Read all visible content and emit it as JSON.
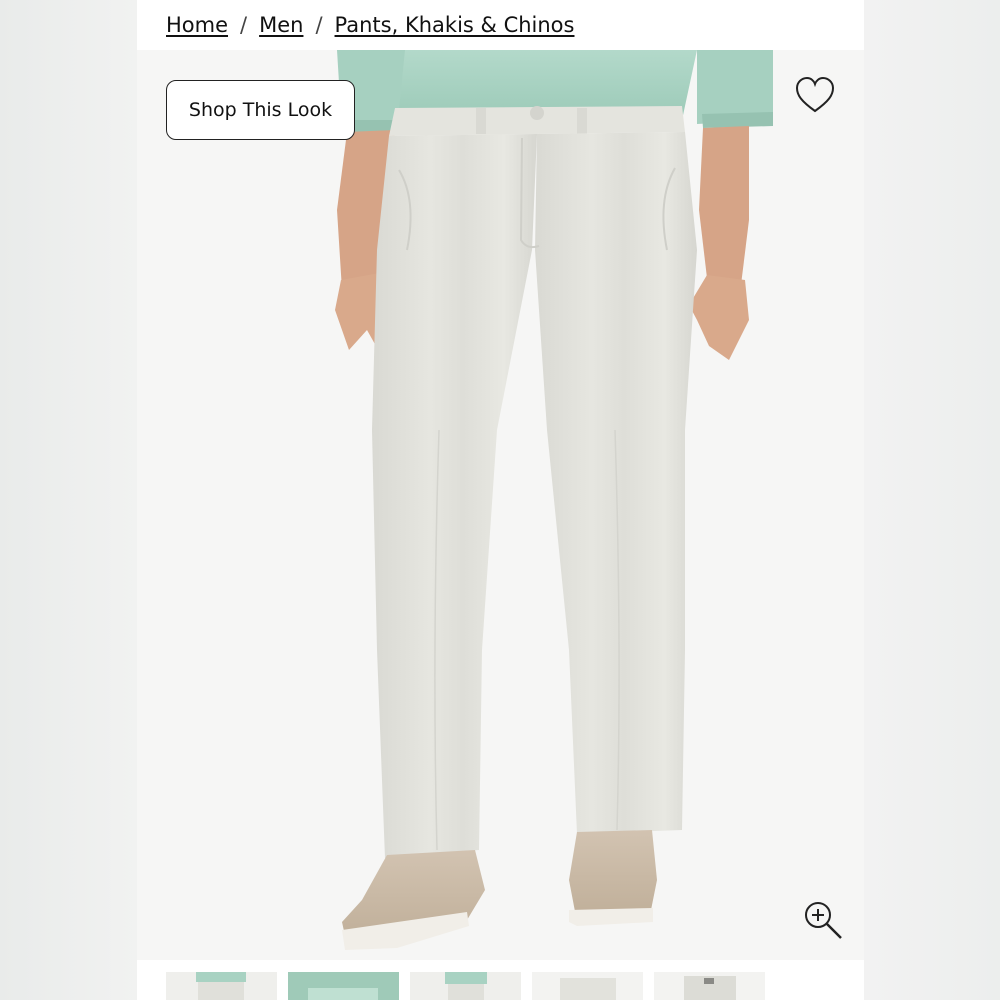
{
  "breadcrumb": {
    "items": [
      {
        "label": "Home"
      },
      {
        "label": "Men"
      },
      {
        "label": "Pants, Khakis & Chinos"
      }
    ],
    "separator": "/"
  },
  "product_image": {
    "shop_look_label": "Shop This Look",
    "favorite_icon": "heart-outline-icon",
    "zoom_icon": "zoom-in-icon"
  },
  "thumbnails": {
    "count": 5,
    "selected_index": 0
  },
  "colors": {
    "shirt": "#a8d2c2",
    "pants": "#e2e2dc",
    "shoes": "#c8b8a5",
    "skin": "#d7a889"
  }
}
